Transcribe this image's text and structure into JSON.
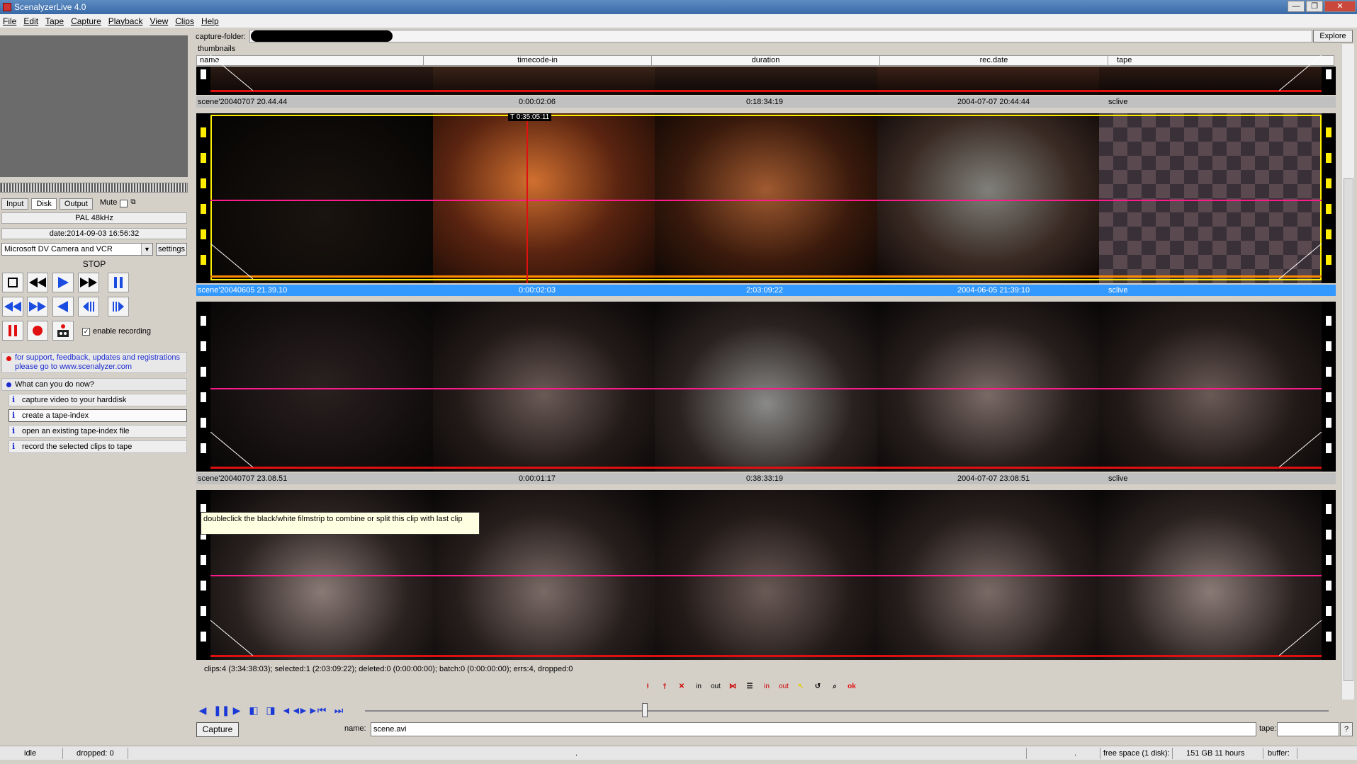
{
  "window": {
    "title": "ScenalyzerLive 4.0",
    "min": "—",
    "max": "❐",
    "close": "✕"
  },
  "menu": [
    "File",
    "Edit",
    "Tape",
    "Capture",
    "Playback",
    "View",
    "Clips",
    "Help"
  ],
  "left": {
    "tabs": [
      "Input",
      "Disk",
      "Output",
      "Mute"
    ],
    "format": "PAL 48kHz",
    "date": "date:2014-09-03 16:56:32",
    "device": "Microsoft DV Camera and VCR",
    "settings_label": "settings",
    "state": "STOP",
    "enable_recording": "enable recording",
    "support_text": "for support, feedback, updates and registrations please go to www.scenalyzer.com",
    "what_now": "What can you do now?",
    "help_items": [
      "capture video to your harddisk",
      "create a tape-index",
      "open an existing tape-index file",
      "record the selected clips to tape"
    ]
  },
  "top": {
    "capture_folder_label": "capture-folder:",
    "explore_label": "Explore",
    "thumbnails_label": "thumbnails"
  },
  "columns": [
    "name",
    "timecode-in",
    "duration",
    "rec.date",
    "tape"
  ],
  "clips": [
    {
      "name": "scene'20040707 20.44.44",
      "timecode_in": "0:00:02:06",
      "duration": "0:18:34:19",
      "rec_date": "2004-07-07 20:44:44",
      "tape": "sclive"
    },
    {
      "name": "scene'20040605 21.39.10",
      "timecode_in": "0:00:02:03",
      "duration": "2:03:09:22",
      "rec_date": "2004-06-05 21:39:10",
      "tape": "sclive",
      "marker": "T 0:35:05:11"
    },
    {
      "name": "scene'20040707 23.08.51",
      "timecode_in": "0:00:01:17",
      "duration": "0:38:33:19",
      "rec_date": "2004-07-07 23:08:51",
      "tape": "sclive"
    }
  ],
  "tooltip": "doubleclick the black/white filmstrip to combine or split this clip with last clip",
  "stats": "clips:4 (3:34:38:03); selected:1 (2:03:09:22); deleted:0 (0:00:00:00); batch:0 (0:00:00:00); errs:4, dropped:0",
  "toolbar": [
    "in",
    "out",
    "in",
    "out",
    "ok"
  ],
  "bottom": {
    "capture_label": "Capture",
    "name_label": "name:",
    "name_value": "scene.avi",
    "tape_label": "tape:",
    "q_label": "?"
  },
  "status": {
    "state": "idle",
    "dropped": "dropped: 0",
    "dot1": ".",
    "dot2": ".",
    "free_space_label": "free space (1 disk):",
    "free_space_value": "151 GB 11 hours",
    "buffer_label": "buffer:"
  }
}
